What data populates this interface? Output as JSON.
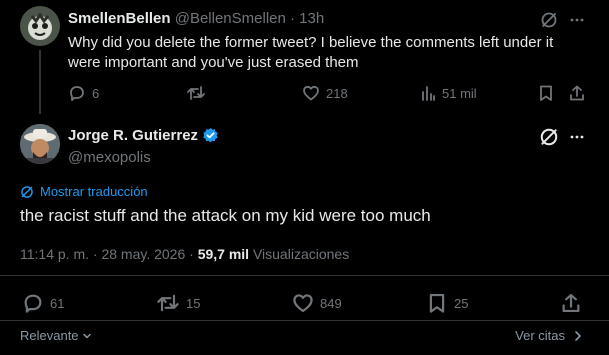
{
  "reply": {
    "name": "SmellenBellen",
    "handle": "@BellenSmellen",
    "time": "· 13h",
    "text": "Why did you delete the former tweet? I believe the comments left under it were important and you've just erased them",
    "replies": "6",
    "likes": "218",
    "views": "51 mil"
  },
  "main": {
    "name": "Jorge R. Gutierrez",
    "handle": "@mexopolis",
    "translate_label": "Mostrar traducción",
    "text": "the racist stuff and the attack on my kid were too much",
    "timestamp": "11:14 p. m. · 28 may. 2026 ·",
    "views_count": "59,7 mil",
    "views_label": "Visualizaciones",
    "replies": "61",
    "reposts": "15",
    "likes": "849",
    "bookmarks": "25"
  },
  "footer": {
    "sort_label": "Relevante",
    "quotes_label": "Ver citas"
  },
  "colors": {
    "background": "#000000",
    "text": "#e7e9ea",
    "muted": "#71767b",
    "accent": "#1d9bf0"
  }
}
